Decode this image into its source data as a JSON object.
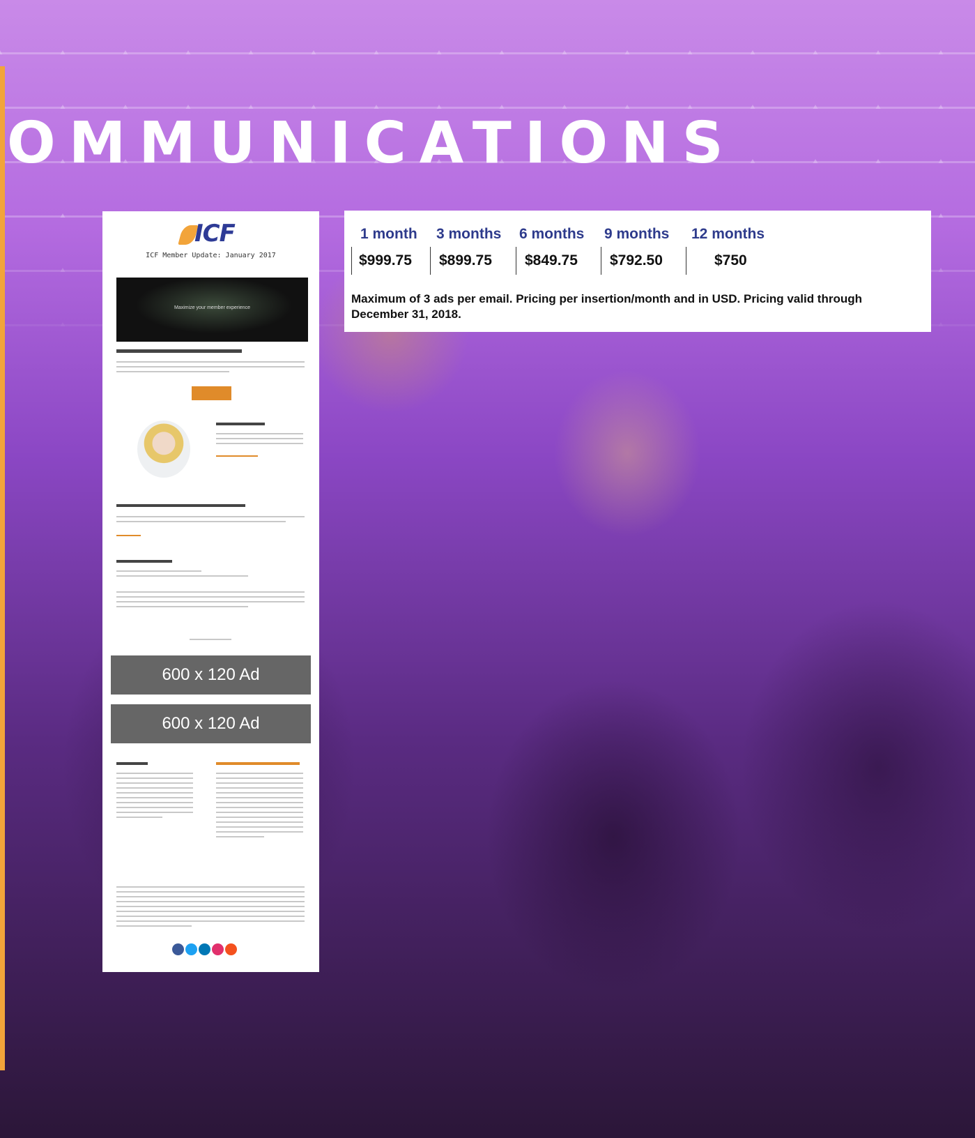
{
  "section_title": "OMMUNICATIONS",
  "email_mockup": {
    "logo_text": "ICF",
    "title": "ICF Member Update: January 2017",
    "hero_caption": "Maximize your member experience",
    "ad_labels": [
      "600 x 120 Ad",
      "600 x 120 Ad"
    ],
    "social_colors": [
      "#3b5998",
      "#1da1f2",
      "#0077b5",
      "#e1306c",
      "#f4511e"
    ]
  },
  "pricing": {
    "durations": [
      "1 month",
      "3 months",
      "6 months",
      "9 months",
      "12 months"
    ],
    "prices": [
      "$999.75",
      "$899.75",
      "$849.75",
      "$792.50",
      "$750"
    ],
    "note": "Maximum of 3 ads per email. Pricing per insertion/month and in USD. Pricing valid through December 31, 2018."
  },
  "colors": {
    "accent": "#f2a43a",
    "heading_blue": "#2e3b8c"
  }
}
